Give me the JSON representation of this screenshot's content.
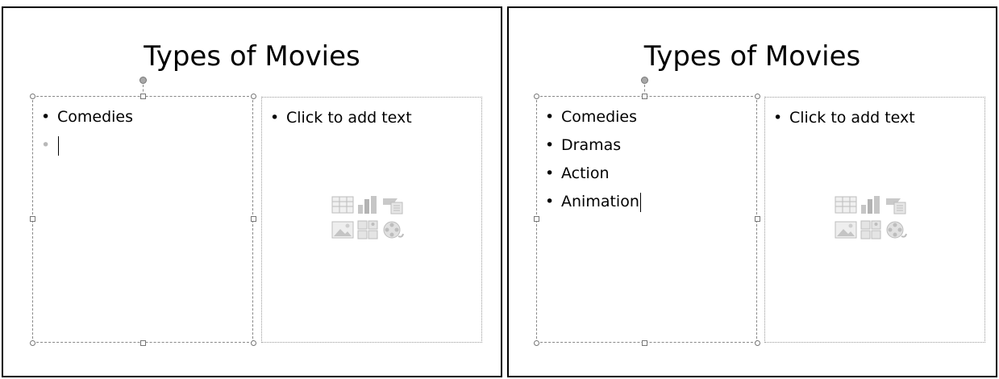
{
  "slides": [
    {
      "title": "Types of Movies",
      "left_bullets": [
        "Comedies"
      ],
      "right_placeholder": "Click to add text"
    },
    {
      "title": "Types of Movies",
      "left_bullets": [
        "Comedies",
        "Dramas",
        "Action",
        "Animation"
      ],
      "right_placeholder": "Click to add text"
    }
  ],
  "content_placeholder_icons": [
    "insert-table-icon",
    "insert-chart-icon",
    "insert-smartart-icon",
    "insert-picture-icon",
    "insert-clip-art-icon",
    "insert-media-clip-icon"
  ]
}
